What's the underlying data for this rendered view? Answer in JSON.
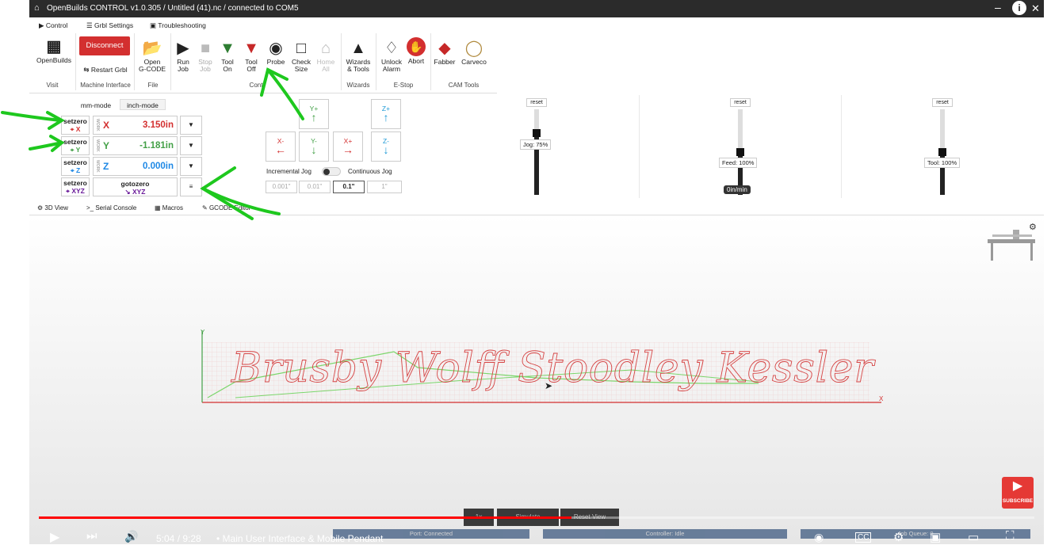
{
  "titlebar": {
    "title": "OpenBuilds CONTROL v1.0.305 / Untitled (41).nc / connected to COM5"
  },
  "tabs": [
    "Control",
    "Grbl Settings",
    "Troubleshooting"
  ],
  "ribbon": {
    "openbuilds": "OpenBuilds",
    "disconnect": "Disconnect",
    "restart": "Restart Grbl",
    "open": [
      "Open",
      "G-CODE"
    ],
    "run": [
      "Run",
      "Job"
    ],
    "stop": [
      "Stop",
      "Job"
    ],
    "toolon": [
      "Tool",
      "On"
    ],
    "tooloff": [
      "Tool",
      "Off"
    ],
    "probe": "Probe",
    "check": [
      "Check",
      "Size"
    ],
    "home": [
      "Home",
      "All"
    ],
    "wizards": [
      "Wizards",
      "& Tools"
    ],
    "unlock": [
      "Unlock",
      "Alarm"
    ],
    "abort": "Abort",
    "fabber": "Fabber",
    "carveco": "Carveco",
    "groups": [
      "Visit",
      "Machine Interface",
      "File",
      "Cont",
      "Wizards",
      "E-Stop",
      "CAM Tools"
    ]
  },
  "dro": {
    "modes": [
      "mm-mode",
      "inch-mode"
    ],
    "setzero": "setzero",
    "gotozero": "gotozero",
    "xyz": "XYZ",
    "work": "WORK",
    "axes": [
      {
        "axis": "X",
        "value": "3.150in",
        "color": "#d32f2f"
      },
      {
        "axis": "Y",
        "value": "-1.181in",
        "color": "#43a047"
      },
      {
        "axis": "Z",
        "value": "0.000in",
        "color": "#1e88e5"
      }
    ]
  },
  "jog": {
    "yplus": "Y+",
    "yminus": "Y-",
    "xminus": "X-",
    "xplus": "X+",
    "zplus": "Z+",
    "zminus": "Z-",
    "incremental": "Incremental Jog",
    "continuous": "Continuous Jog",
    "steps": [
      "0.001\"",
      "0.01\"",
      "0.1\"",
      "1\""
    ]
  },
  "overrides": [
    {
      "reset": "reset",
      "label": "Jog: 75%",
      "level": 0.75
    },
    {
      "reset": "reset",
      "label": "Feed: 100%",
      "level": 0.5,
      "rate": "0in/min"
    },
    {
      "reset": "reset",
      "label": "Tool: 100%",
      "level": 0.5
    }
  ],
  "viewtabs": [
    "3D View",
    "Serial Console",
    "Macros",
    "GCODE Editor"
  ],
  "viewport": {
    "text": "Brusby Wolff Stoodley Kessler",
    "yaxis": "Y",
    "xaxis": "X",
    "buttons": [
      "1x",
      "Simulate",
      "Reset View"
    ]
  },
  "statusbar": {
    "port": "Port: Connected",
    "controller": "Controller: Idle",
    "queue": "Job Queue: 0"
  },
  "youtube": {
    "time": "5:04 / 9:28",
    "chapter": "• Main User Interface & Mobile Pendant",
    "subscribe": "SUBSCRIBE",
    "progress": 0.535
  }
}
